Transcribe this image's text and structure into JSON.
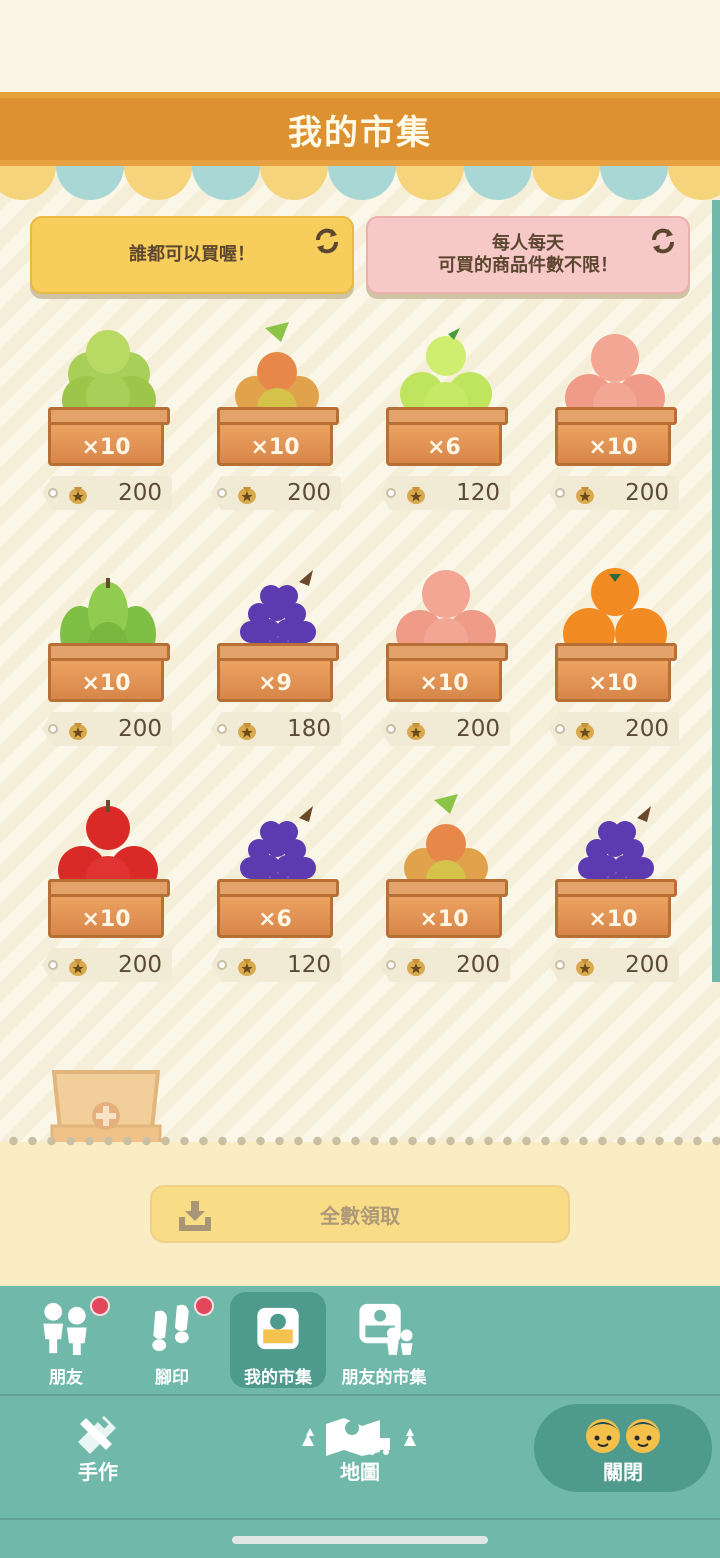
{
  "header": {
    "title": "我的市集"
  },
  "rules": {
    "left_label": "誰都可以買喔！",
    "right_line1": "每人每天",
    "right_line2": "可買的商品件數不限！"
  },
  "items": [
    {
      "fruit": "pear",
      "qty": "×10",
      "price": "200"
    },
    {
      "fruit": "lychee",
      "qty": "×10",
      "price": "200"
    },
    {
      "fruit": "lime",
      "qty": "×6",
      "price": "120"
    },
    {
      "fruit": "peach",
      "qty": "×10",
      "price": "200"
    },
    {
      "fruit": "green-pear",
      "qty": "×10",
      "price": "200"
    },
    {
      "fruit": "grape",
      "qty": "×9",
      "price": "180"
    },
    {
      "fruit": "peach",
      "qty": "×10",
      "price": "200"
    },
    {
      "fruit": "orange",
      "qty": "×10",
      "price": "200"
    },
    {
      "fruit": "apple",
      "qty": "×10",
      "price": "200"
    },
    {
      "fruit": "grape",
      "qty": "×6",
      "price": "120"
    },
    {
      "fruit": "lychee",
      "qty": "×10",
      "price": "200"
    },
    {
      "fruit": "grape",
      "qty": "×10",
      "price": "200"
    }
  ],
  "claim": {
    "label": "全數領取"
  },
  "nav": {
    "friends": "朋友",
    "footprints": "腳印",
    "my_market": "我的市集",
    "friend_market": "朋友的市集",
    "craft": "手作",
    "map": "地圖",
    "close": "關閉"
  },
  "colors": {
    "header": "#dd9130",
    "nav": "#6fb8aa",
    "nav_active": "#4e9a8c",
    "badge": "#e2485c"
  }
}
